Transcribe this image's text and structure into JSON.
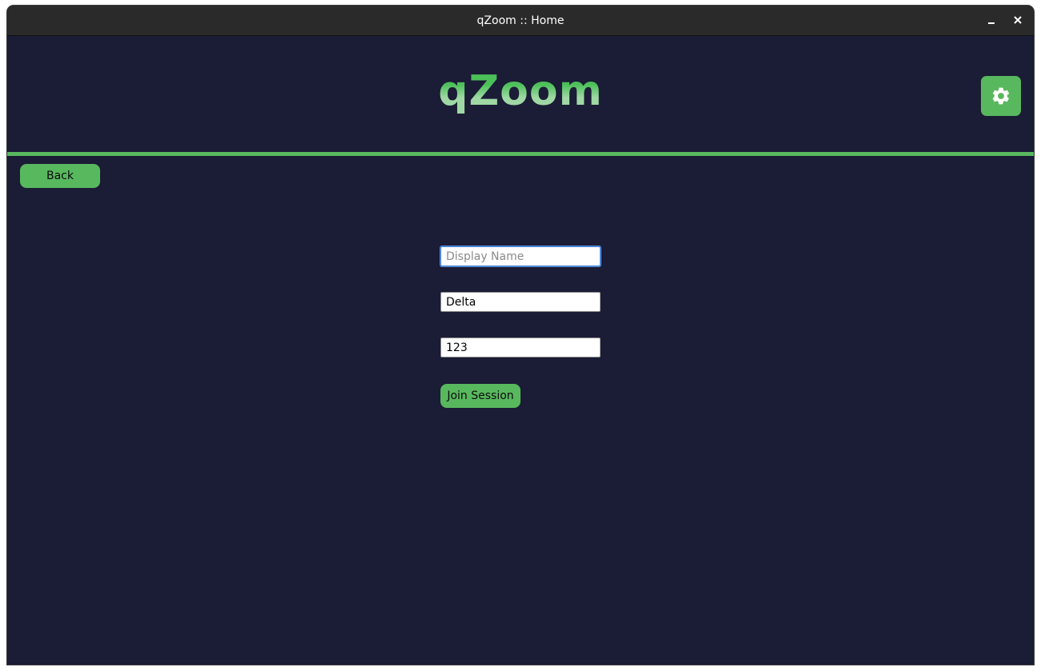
{
  "window": {
    "title": "qZoom :: Home",
    "minimize_icon": "minimize-icon",
    "close_icon": "close-icon"
  },
  "header": {
    "app_title": "qZoom",
    "settings_icon": "gear-icon"
  },
  "nav": {
    "back_label": "Back"
  },
  "form": {
    "display_name": {
      "placeholder": "Display Name",
      "value": ""
    },
    "session_name": {
      "placeholder": "",
      "value": "Delta"
    },
    "session_password": {
      "placeholder": "",
      "value": "123"
    },
    "join_label": "Join Session"
  },
  "colors": {
    "background": "#1b1c36",
    "accent": "#58b85e",
    "titlebar": "#2a2a2a"
  }
}
